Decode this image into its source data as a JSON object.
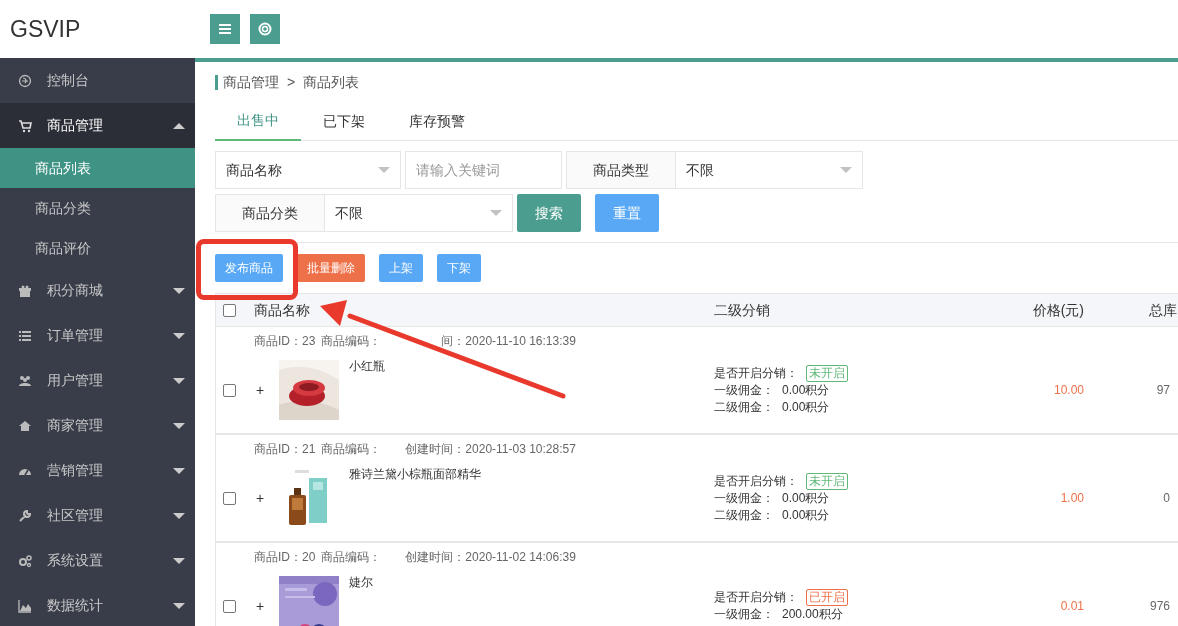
{
  "logo": "GSVIP",
  "toolbar": [
    {
      "kind": "menu"
    },
    {
      "kind": "help"
    }
  ],
  "sidebar": {
    "items": [
      {
        "label": "控制台",
        "expanded": false,
        "collapsible": false
      },
      {
        "label": "商品管理",
        "expanded": true,
        "collapsible": true,
        "children": [
          {
            "label": "商品列表",
            "selected": true
          },
          {
            "label": "商品分类",
            "selected": false
          },
          {
            "label": "商品评价",
            "selected": false
          }
        ]
      },
      {
        "label": "积分商城",
        "expanded": false,
        "collapsible": true
      },
      {
        "label": "订单管理",
        "expanded": false,
        "collapsible": true
      },
      {
        "label": "用户管理",
        "expanded": false,
        "collapsible": true
      },
      {
        "label": "商家管理",
        "expanded": false,
        "collapsible": true
      },
      {
        "label": "营销管理",
        "expanded": false,
        "collapsible": true
      },
      {
        "label": "社区管理",
        "expanded": false,
        "collapsible": true
      },
      {
        "label": "系统设置",
        "expanded": false,
        "collapsible": true
      },
      {
        "label": "数据统计",
        "expanded": false,
        "collapsible": true
      }
    ]
  },
  "breadcrumb": [
    "商品管理",
    ">",
    "商品列表"
  ],
  "tabs": [
    {
      "label": "出售中",
      "selected": true
    },
    {
      "label": "已下架",
      "selected": false
    },
    {
      "label": "库存预警",
      "selected": false
    }
  ],
  "filters": [
    {
      "kind": "select",
      "value": "商品名称"
    },
    {
      "kind": "input",
      "placeholder": "请输入关键词"
    },
    {
      "kind": "labeled-select",
      "label": "商品类型",
      "value": "不限"
    },
    {
      "kind": "labeled-select",
      "label": "商品分类",
      "value": "不限"
    },
    {
      "kind": "button",
      "label": "搜索",
      "color": "#4a9d8f"
    },
    {
      "kind": "button",
      "label": "重置",
      "color": "#58a8f5"
    }
  ],
  "actions": [
    {
      "label": "发布商品",
      "color": "#58a8f5"
    },
    {
      "label": "批量删除",
      "color": "#ee7048"
    },
    {
      "label": "上架",
      "color": "#58a8f5"
    },
    {
      "label": "下架",
      "color": "#58a8f5"
    }
  ],
  "table": {
    "header_checked": false,
    "columns": [
      "商品名称",
      "二级分销",
      "价格(元)",
      "总库"
    ],
    "rows": [
      {
        "id": "商品ID：23",
        "code": "商品编码：",
        "created": "间：2020-11-10 16:13:39",
        "created_covered": true,
        "checked": false,
        "expand": "+",
        "name": "小红瓶",
        "distribution_label": "是否开启分销：",
        "distribution_on": false,
        "distribution_status": "未开启",
        "commissions": [
          {
            "label": "一级佣金：",
            "value": "0.00积分"
          },
          {
            "label": "二级佣金：",
            "value": "0.00积分"
          }
        ],
        "price": "10.00",
        "stock": "97"
      },
      {
        "id": "商品ID：21",
        "code": "商品编码：",
        "created": "创建时间：2020-11-03 10:28:57",
        "checked": false,
        "expand": "+",
        "name": "雅诗兰黛小棕瓶面部精华",
        "distribution_label": "是否开启分销：",
        "distribution_on": false,
        "distribution_status": "未开启",
        "commissions": [
          {
            "label": "一级佣金：",
            "value": "0.00积分"
          },
          {
            "label": "二级佣金：",
            "value": "0.00积分"
          }
        ],
        "price": "1.00",
        "stock": "0"
      },
      {
        "id": "商品ID：20",
        "code": "商品编码：",
        "created": "创建时间：2020-11-02 14:06:39",
        "checked": false,
        "expand": "+",
        "name": "婕尔",
        "distribution_label": "是否开启分销：",
        "distribution_on": true,
        "distribution_status": "已开启",
        "commissions": [
          {
            "label": "一级佣金：",
            "value": "200.00积分"
          }
        ],
        "price": "0.01",
        "stock": "976"
      }
    ]
  },
  "annotation": {
    "kind": "highlight-arrow"
  }
}
